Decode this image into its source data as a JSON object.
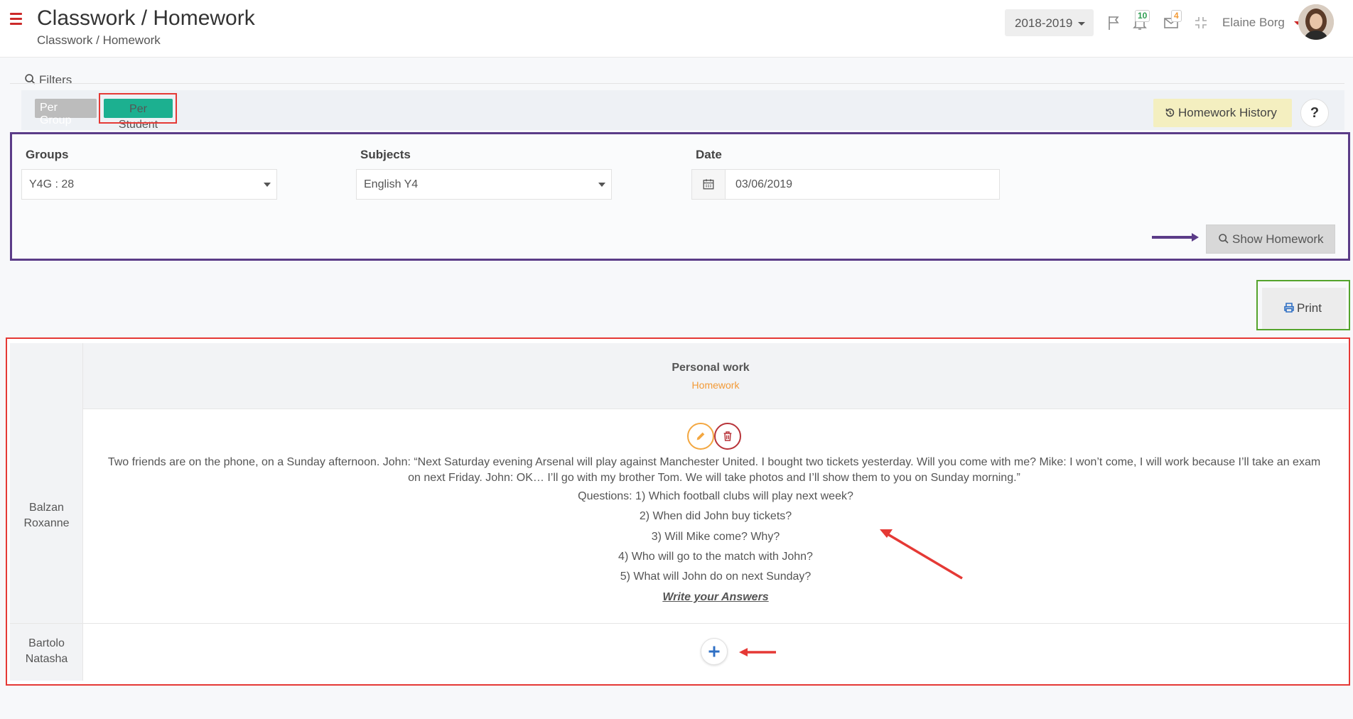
{
  "header": {
    "title": "Classwork / Homework",
    "breadcrumb": "Classwork / Homework",
    "year": "2018-2019",
    "notifications_count": "10",
    "messages_count": "4",
    "user_name": "Elaine Borg"
  },
  "filters": {
    "label": "Filters",
    "toggle_group": "Per Group",
    "toggle_student": "Per Student",
    "history_button": "Homework History",
    "help_button": "?",
    "groups_label": "Groups",
    "groups_value": "Y4G : 28",
    "subjects_label": "Subjects",
    "subjects_value": "English Y4",
    "date_label": "Date",
    "date_value": "03/06/2019",
    "show_button": "Show Homework"
  },
  "print_button": "Print",
  "table": {
    "header_title": "Personal work",
    "header_sub": "Homework",
    "students": [
      {
        "name_line1": "Balzan",
        "name_line2": "Roxanne"
      },
      {
        "name_line1": "Bartolo",
        "name_line2": "Natasha"
      }
    ],
    "homework_text": "Two friends are on the phone, on a Sunday afternoon. John: “Next Saturday evening Arsenal will play against Manchester United. I bought two tickets yesterday. Will you come with me? Mike: I won’t come, I will work because I’ll take an exam on next Friday. John: OK… I’ll go with my brother Tom. We will take photos and I’ll show them to you on Sunday morning.”",
    "questions": [
      "Questions: 1) Which football clubs will play next week?",
      "2) When did John buy tickets?",
      "3) Will Mike come? Why?",
      "4) Who will go to the match with John?",
      "5) What will John do on next Sunday?"
    ],
    "answers_link": "Write your Answers"
  },
  "colors": {
    "accent_red": "#cc2a2a",
    "per_student_green": "#1cb090",
    "homework_orange": "#f39a36",
    "highlight_purple": "#5b3c88",
    "highlight_red": "#e53935",
    "highlight_green": "#54a42c"
  }
}
